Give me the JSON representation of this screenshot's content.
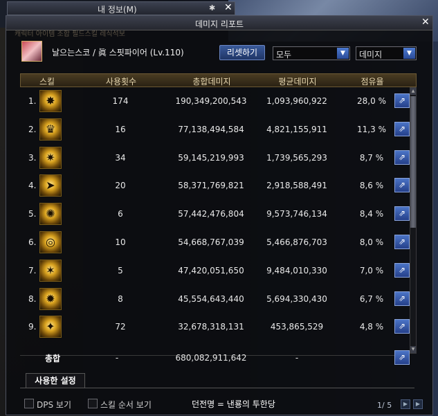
{
  "info_window": {
    "title": "내 정보(M)",
    "pin": "✱",
    "close": "✕"
  },
  "report": {
    "title": "데미지 리포트",
    "close": "✕",
    "ghost_tabs": "캐릭터   아이템 조합   필드스킬   레식석보",
    "character": "날으는스코 / 眞 스핏파이어 (Lv.110)",
    "reset_button": "리셋하기",
    "filter_select": "모두",
    "metric_select": "데미지",
    "headers": {
      "skill": "스킬",
      "uses": "사용횟수",
      "total": "총합데미지",
      "avg": "평균데미지",
      "share": "점유율"
    },
    "rows": [
      {
        "num": "1.",
        "icon": "grenade-burst-icon",
        "glyph": "✸",
        "uses": "174",
        "total": "190,349,200,543",
        "avg": "1,093,960,922",
        "share": "28,0 %"
      },
      {
        "num": "2.",
        "icon": "ring-crown-icon",
        "glyph": "♛",
        "uses": "16",
        "total": "77,138,494,584",
        "avg": "4,821,155,911",
        "share": "11,3 %"
      },
      {
        "num": "3.",
        "icon": "light-burst-icon",
        "glyph": "✷",
        "uses": "34",
        "total": "59,145,219,993",
        "avg": "1,739,565,293",
        "share": "8,7 %"
      },
      {
        "num": "4.",
        "icon": "bullet-blast-icon",
        "glyph": "➤",
        "uses": "20",
        "total": "58,371,769,821",
        "avg": "2,918,588,491",
        "share": "8,6 %"
      },
      {
        "num": "5.",
        "icon": "explosion-tree-icon",
        "glyph": "✺",
        "uses": "6",
        "total": "57,442,476,804",
        "avg": "9,573,746,134",
        "share": "8,4 %"
      },
      {
        "num": "6.",
        "icon": "vortex-ring-icon",
        "glyph": "◎",
        "uses": "10",
        "total": "54,668,767,039",
        "avg": "5,466,876,703",
        "share": "8,0 %"
      },
      {
        "num": "7.",
        "icon": "multi-shot-icon",
        "glyph": "✶",
        "uses": "5",
        "total": "47,420,051,650",
        "avg": "9,484,010,330",
        "share": "7,0 %"
      },
      {
        "num": "8.",
        "icon": "ground-blast-icon",
        "glyph": "✹",
        "uses": "8",
        "total": "45,554,643,440",
        "avg": "5,694,330,430",
        "share": "6,7 %"
      },
      {
        "num": "9.",
        "icon": "bomb-toss-icon",
        "glyph": "✦",
        "uses": "72",
        "total": "32,678,318,131",
        "avg": "453,865,529",
        "share": "4,8 %"
      }
    ],
    "total_row": {
      "label": "총합",
      "uses": "-",
      "total": "680,082,911,642",
      "avg": "-"
    },
    "share_glyph": "⇗",
    "used_settings_tab": "사용한 설정",
    "footer": {
      "dps_label": "DPS 보기",
      "skill_order_label": "스킬 순서 보기",
      "dungeon": "던전명 = 낸룡의 투한당",
      "page": "1/ 5"
    }
  }
}
